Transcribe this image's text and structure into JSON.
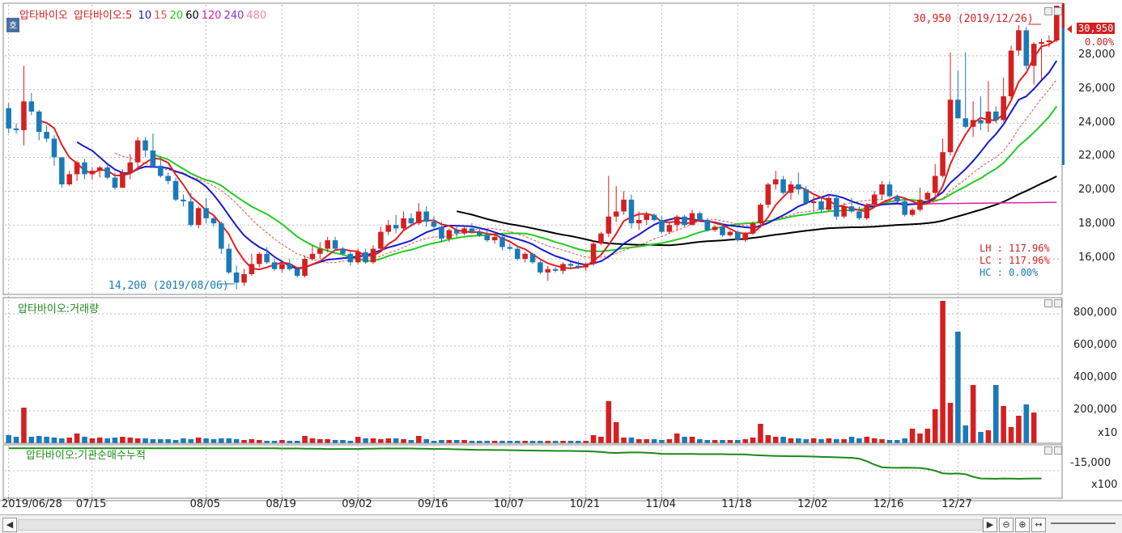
{
  "legend": {
    "stock": "압타바이오",
    "ma_prefix": "압타바이오:5",
    "ma_items": [
      {
        "label": "10",
        "color": "#1a1acc"
      },
      {
        "label": "15",
        "color": "#e05050"
      },
      {
        "label": "20",
        "color": "#22cc22"
      },
      {
        "label": "60",
        "color": "#000000"
      },
      {
        "label": "120",
        "color": "#dd22aa"
      },
      {
        "label": "240",
        "color": "#8833cc"
      },
      {
        "label": "480",
        "color": "#ee88aa"
      }
    ],
    "volume_title": "압타바이오:거래량",
    "inst_title": "압타바이오:기관순매수누적"
  },
  "badge_label": "호",
  "annotations": {
    "high": "30,950 (2019/12/26)",
    "low": "14,200 (2019/08/06)",
    "last_price": "30,950",
    "last_change": "0.00%",
    "lh": "LH : 117.96%",
    "lc": "LC : 117.96%",
    "hc": "HC :   0.00%"
  },
  "price_axis": [
    "28,000",
    "26,000",
    "24,000",
    "22,000",
    "20,000",
    "18,000",
    "16,000"
  ],
  "volume_axis": [
    "800,000",
    "600,000",
    "400,000",
    "200,000"
  ],
  "volume_unit": "x10",
  "inst_axis": [
    "-15,000"
  ],
  "inst_unit": "x100",
  "date_labels": [
    "2019/06/28",
    "07/15",
    "08/05",
    "08/19",
    "09/02",
    "09/16",
    "10/07",
    "10/21",
    "11/04",
    "11/18",
    "12/02",
    "12/16",
    "12/27"
  ],
  "colors": {
    "up": "#d42020",
    "down": "#1a7ab8",
    "ma5": "#e02020",
    "ma10": "#1a1acc",
    "ma15": "#e05050",
    "ma20": "#22cc22",
    "ma60": "#000000",
    "ma120": "#dd22aa",
    "inst": "#1a8a1a"
  },
  "chart_data": {
    "type": "candlestick",
    "price_range": [
      14000,
      31000
    ],
    "candles": [
      [
        24900,
        25200,
        23400,
        23700
      ],
      [
        23700,
        24000,
        23400,
        23600
      ],
      [
        23600,
        27400,
        22700,
        25300
      ],
      [
        25300,
        25800,
        24500,
        24700
      ],
      [
        24700,
        24800,
        23000,
        23500
      ],
      [
        23500,
        23900,
        22900,
        23100
      ],
      [
        23100,
        23300,
        21500,
        22000
      ],
      [
        22000,
        22000,
        20200,
        20400
      ],
      [
        20400,
        21200,
        20300,
        21000
      ],
      [
        21000,
        21800,
        20600,
        21700
      ],
      [
        21700,
        21900,
        20700,
        21000
      ],
      [
        21000,
        21400,
        20700,
        21200
      ],
      [
        21200,
        21500,
        20800,
        21400
      ],
      [
        21400,
        21600,
        20700,
        20800
      ],
      [
        20800,
        21100,
        20100,
        20200
      ],
      [
        20200,
        21300,
        20200,
        21100
      ],
      [
        21100,
        22200,
        20700,
        21700
      ],
      [
        21700,
        23200,
        21200,
        23000
      ],
      [
        23000,
        23200,
        22000,
        22400
      ],
      [
        22400,
        23400,
        21400,
        21500
      ],
      [
        21500,
        22000,
        20800,
        20900
      ],
      [
        20900,
        21100,
        20400,
        20600
      ],
      [
        20600,
        20800,
        19400,
        19500
      ],
      [
        19500,
        19800,
        19100,
        19400
      ],
      [
        19400,
        19900,
        17900,
        18000
      ],
      [
        18000,
        19100,
        17800,
        19000
      ],
      [
        19000,
        19600,
        18100,
        18400
      ],
      [
        18400,
        18500,
        17900,
        18100
      ],
      [
        18100,
        18200,
        16300,
        16600
      ],
      [
        16600,
        16900,
        15100,
        15200
      ],
      [
        15200,
        15600,
        14200,
        14600
      ],
      [
        14600,
        15400,
        14400,
        15100
      ],
      [
        15100,
        16300,
        15000,
        15700
      ],
      [
        15700,
        16400,
        15500,
        16300
      ],
      [
        16300,
        16700,
        15700,
        15800
      ],
      [
        15800,
        16000,
        15300,
        15400
      ],
      [
        15400,
        15800,
        15200,
        15700
      ],
      [
        15700,
        16000,
        15300,
        15400
      ],
      [
        15400,
        15500,
        14900,
        15000
      ],
      [
        15000,
        16200,
        14900,
        16000
      ],
      [
        16000,
        16800,
        15900,
        16300
      ],
      [
        16300,
        17000,
        16000,
        16600
      ],
      [
        16600,
        17300,
        16400,
        17100
      ],
      [
        17100,
        17300,
        16500,
        16600
      ],
      [
        16600,
        16700,
        16200,
        16300
      ],
      [
        16300,
        16500,
        15600,
        15800
      ],
      [
        15800,
        16600,
        15700,
        16400
      ],
      [
        16400,
        16600,
        15700,
        15800
      ],
      [
        15800,
        16800,
        15700,
        16600
      ],
      [
        16600,
        17900,
        16500,
        17600
      ],
      [
        17600,
        18300,
        17400,
        18000
      ],
      [
        18000,
        18600,
        17500,
        17800
      ],
      [
        17800,
        18800,
        17700,
        18400
      ],
      [
        18400,
        18700,
        17900,
        18100
      ],
      [
        18100,
        19300,
        18000,
        18800
      ],
      [
        18800,
        19100,
        17900,
        18200
      ],
      [
        18200,
        18500,
        17700,
        17900
      ],
      [
        17900,
        18200,
        17000,
        17200
      ],
      [
        17200,
        17800,
        17000,
        17700
      ],
      [
        17700,
        17900,
        17300,
        17500
      ],
      [
        17500,
        17900,
        17400,
        17800
      ],
      [
        17800,
        18100,
        17500,
        17600
      ],
      [
        17600,
        17900,
        17300,
        17400
      ],
      [
        17400,
        17700,
        17000,
        17100
      ],
      [
        17100,
        17600,
        16900,
        17300
      ],
      [
        17300,
        17500,
        16500,
        16700
      ],
      [
        16700,
        16900,
        16500,
        16600
      ],
      [
        16600,
        16800,
        15900,
        16000
      ],
      [
        16000,
        16400,
        15800,
        16300
      ],
      [
        16300,
        16300,
        15700,
        15800
      ],
      [
        15800,
        15900,
        15100,
        15200
      ],
      [
        15200,
        15600,
        14700,
        15400
      ],
      [
        15400,
        15500,
        15200,
        15300
      ],
      [
        15300,
        15800,
        15100,
        15700
      ],
      [
        15700,
        15800,
        15500,
        15600
      ],
      [
        15600,
        15900,
        15400,
        15500
      ],
      [
        15500,
        15800,
        15300,
        15700
      ],
      [
        15700,
        17100,
        15600,
        16900
      ],
      [
        16900,
        17600,
        16800,
        17500
      ],
      [
        17500,
        20900,
        17300,
        18500
      ],
      [
        18500,
        20300,
        18200,
        18800
      ],
      [
        18800,
        20000,
        18600,
        19500
      ],
      [
        19500,
        19800,
        17800,
        18100
      ],
      [
        18100,
        18800,
        17700,
        18300
      ],
      [
        18300,
        18800,
        18000,
        18600
      ],
      [
        18600,
        18700,
        18200,
        18300
      ],
      [
        18300,
        18500,
        17500,
        17600
      ],
      [
        17600,
        18200,
        17500,
        18000
      ],
      [
        18000,
        18600,
        17700,
        18500
      ],
      [
        18500,
        18600,
        17900,
        18000
      ],
      [
        18000,
        18900,
        18000,
        18700
      ],
      [
        18700,
        18800,
        18200,
        18300
      ],
      [
        18300,
        18400,
        17600,
        17700
      ],
      [
        17700,
        18000,
        17600,
        17900
      ],
      [
        17900,
        18000,
        17300,
        17400
      ],
      [
        17400,
        17700,
        17300,
        17600
      ],
      [
        17600,
        17700,
        17000,
        17100
      ],
      [
        17100,
        17600,
        17000,
        17500
      ],
      [
        17500,
        18200,
        17400,
        18100
      ],
      [
        18100,
        19300,
        18000,
        19200
      ],
      [
        19200,
        20500,
        19000,
        20400
      ],
      [
        20400,
        21200,
        20100,
        20700
      ],
      [
        20700,
        20900,
        19800,
        19900
      ],
      [
        19900,
        20600,
        19500,
        20400
      ],
      [
        20400,
        21100,
        19800,
        20100
      ],
      [
        20100,
        20300,
        19200,
        19300
      ],
      [
        19300,
        19700,
        18900,
        19400
      ],
      [
        19400,
        19600,
        18700,
        18900
      ],
      [
        18900,
        19800,
        18800,
        19600
      ],
      [
        19600,
        19800,
        18300,
        18500
      ],
      [
        18500,
        19300,
        18400,
        19100
      ],
      [
        19100,
        19600,
        18700,
        18800
      ],
      [
        18800,
        19100,
        18300,
        18400
      ],
      [
        18400,
        19300,
        18300,
        19200
      ],
      [
        19200,
        20000,
        19000,
        19800
      ],
      [
        19800,
        20600,
        19500,
        20400
      ],
      [
        20400,
        20600,
        19600,
        19700
      ],
      [
        19700,
        19800,
        19300,
        19400
      ],
      [
        19400,
        19600,
        18500,
        18600
      ],
      [
        18600,
        19000,
        18500,
        18900
      ],
      [
        18900,
        20200,
        18800,
        19500
      ],
      [
        19500,
        20000,
        19300,
        19900
      ],
      [
        19900,
        21600,
        19600,
        20900
      ],
      [
        20900,
        23100,
        20800,
        22300
      ],
      [
        22300,
        28200,
        22100,
        25400
      ],
      [
        25400,
        27100,
        24300,
        24300
      ],
      [
        24300,
        28200,
        23700,
        23800
      ],
      [
        23800,
        25300,
        23200,
        24200
      ],
      [
        24200,
        25600,
        23600,
        24000
      ],
      [
        24000,
        26500,
        23500,
        24700
      ],
      [
        24700,
        25000,
        24000,
        24200
      ],
      [
        24200,
        26700,
        24100,
        25600
      ],
      [
        25600,
        28600,
        25400,
        28300
      ],
      [
        28300,
        29800,
        28000,
        29500
      ],
      [
        29500,
        29700,
        27200,
        27400
      ],
      [
        27400,
        28800,
        26300,
        28700
      ],
      [
        28700,
        29000,
        26600,
        28800
      ],
      [
        28800,
        29200,
        28500,
        28900
      ],
      [
        28900,
        30950,
        28800,
        30950
      ]
    ],
    "volume_range": [
      0,
      900000
    ],
    "volume": [
      50000,
      40000,
      220000,
      40000,
      45000,
      40000,
      35000,
      30000,
      35000,
      60000,
      40000,
      30000,
      35000,
      30000,
      35000,
      40000,
      35000,
      30000,
      30000,
      25000,
      25000,
      25000,
      20000,
      30000,
      25000,
      35000,
      30000,
      25000,
      30000,
      30000,
      25000,
      20000,
      25000,
      20000,
      15000,
      15000,
      20000,
      15000,
      15000,
      45000,
      30000,
      25000,
      25000,
      20000,
      20000,
      15000,
      40000,
      30000,
      30000,
      25000,
      30000,
      30000,
      25000,
      20000,
      45000,
      25000,
      15000,
      20000,
      20000,
      20000,
      20000,
      15000,
      15000,
      15000,
      15000,
      15000,
      15000,
      15000,
      15000,
      15000,
      15000,
      15000,
      15000,
      15000,
      15000,
      15000,
      15000,
      50000,
      40000,
      260000,
      130000,
      35000,
      35000,
      25000,
      25000,
      25000,
      20000,
      25000,
      60000,
      40000,
      40000,
      25000,
      20000,
      20000,
      20000,
      20000,
      20000,
      25000,
      35000,
      120000,
      50000,
      40000,
      40000,
      30000,
      30000,
      25000,
      30000,
      25000,
      30000,
      25000,
      25000,
      40000,
      30000,
      40000,
      30000,
      25000,
      20000,
      20000,
      30000,
      90000,
      60000,
      90000,
      210000,
      880000,
      250000,
      690000,
      110000,
      360000,
      70000,
      80000,
      360000,
      230000,
      100000,
      170000,
      240000,
      190000
    ],
    "inst_range": [
      -30000,
      0
    ],
    "inst": [
      -2000,
      -2000,
      -2000,
      -2000,
      -2000,
      -2000,
      -2000,
      -2000,
      -2000,
      -2000,
      -2000,
      -2000,
      -2000,
      -2000,
      -2000,
      -2000,
      -2000,
      -2000,
      -2000,
      -2000,
      -2000,
      -2000,
      -2000,
      -2000,
      -2000,
      -2000,
      -2000,
      -2000,
      -2000,
      -2000,
      -2000,
      -2000,
      -2000,
      -2000,
      -2000,
      -2000,
      -2100,
      -2100,
      -2100,
      -2200,
      -2200,
      -2300,
      -2400,
      -2400,
      -2400,
      -2400,
      -2400,
      -2200,
      -2200,
      -2100,
      -2100,
      -2100,
      -2100,
      -2100,
      -2200,
      -2300,
      -2400,
      -2400,
      -2500,
      -2600,
      -2700,
      -2800,
      -2900,
      -2900,
      -3000,
      -3000,
      -3100,
      -3200,
      -3300,
      -3300,
      -3400,
      -3400,
      -3500,
      -3500,
      -3500,
      -3600,
      -3700,
      -3900,
      -4100,
      -4600,
      -4700,
      -4500,
      -4400,
      -4400,
      -4600,
      -4800,
      -5200,
      -5300,
      -5300,
      -5300,
      -5300,
      -5400,
      -5400,
      -5400,
      -5400,
      -5500,
      -5500,
      -5600,
      -5900,
      -6100,
      -6300,
      -6400,
      -6500,
      -6600,
      -6600,
      -6700,
      -6800,
      -7000,
      -7100,
      -7200,
      -7400,
      -7500,
      -8000,
      -9500,
      -11500,
      -13000,
      -13200,
      -13300,
      -13200,
      -13300,
      -13400,
      -14000,
      -15000,
      -16500,
      -16800,
      -16600,
      -17000,
      -18500,
      -19500,
      -19600,
      -19700,
      -19500,
      -19600,
      -19700,
      -19600,
      -19500,
      -19500
    ]
  }
}
